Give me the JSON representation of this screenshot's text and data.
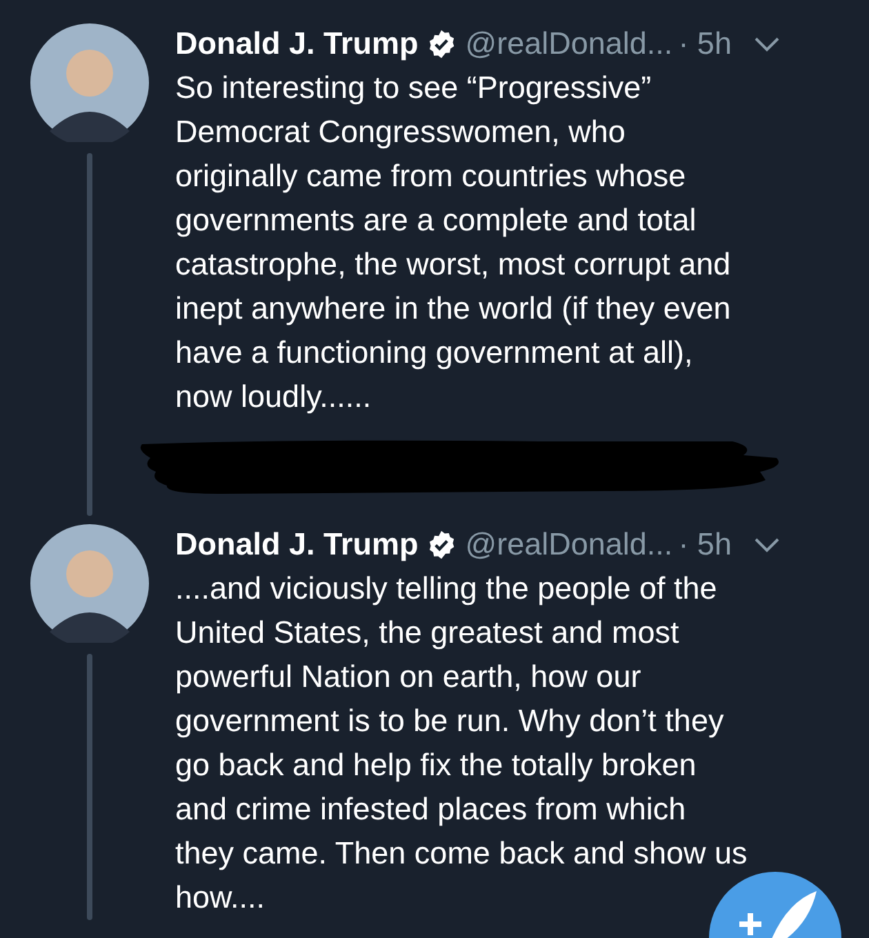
{
  "tweets": [
    {
      "name": "Donald J. Trump",
      "verified": true,
      "handle": "@realDonald...",
      "time": "· 5h",
      "thread_line": true,
      "redacted": true,
      "lines": [
        "So interesting to see “Progressive”",
        "Democrat Congresswomen, who",
        "originally came from countries whose",
        "governments are a complete and total",
        "catastrophe, the worst, most corrupt and",
        "inept anywhere in the world (if they even",
        "have a functioning government at all),",
        "now loudly......"
      ]
    },
    {
      "name": "Donald J. Trump",
      "verified": true,
      "handle": "@realDonald...",
      "time": "· 5h",
      "thread_line": true,
      "redacted": false,
      "lines": [
        "....and viciously telling the people of the",
        "United States, the greatest and most",
        "powerful Nation on earth, how our",
        "government is to be run. Why don’t they",
        "go back and help fix the totally broken",
        "and crime infested places from which",
        "they came. Then come back and show us",
        "how...."
      ]
    }
  ]
}
